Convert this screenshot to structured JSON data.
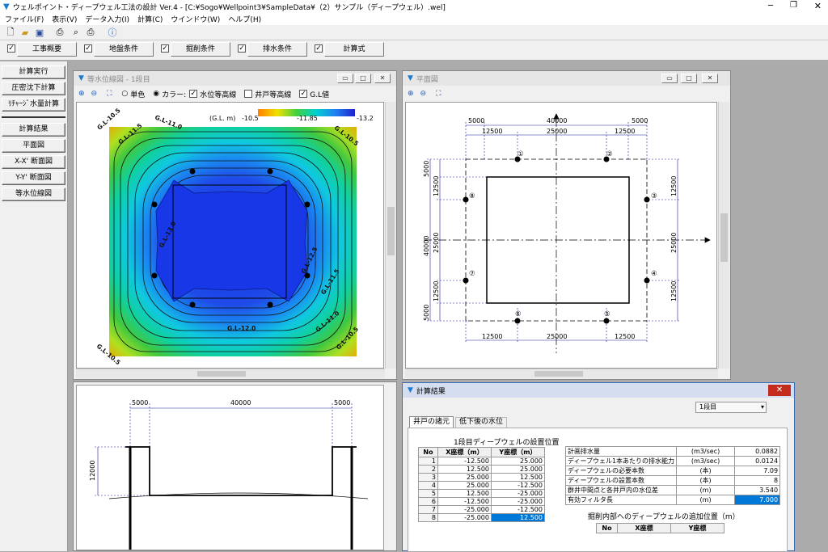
{
  "app": {
    "title": "ウェルポイント・ディープウェル工法の設計 Ver.4 - [C:¥Sogo¥Wellpoint3¥SampleData¥（2）サンプル（ディープウェル）.wel]",
    "menu": [
      "ファイル(F)",
      "表示(V)",
      "データ入力(I)",
      "計算(C)",
      "ウインドウ(W)",
      "ヘルプ(H)"
    ]
  },
  "tabs": [
    {
      "label": "工事概要",
      "checked": true
    },
    {
      "label": "地盤条件",
      "checked": true
    },
    {
      "label": "掘削条件",
      "checked": true
    },
    {
      "label": "排水条件",
      "checked": true
    },
    {
      "label": "計算式",
      "checked": true
    }
  ],
  "sidebar": {
    "top": [
      "計算実行",
      "圧密沈下計算",
      "ﾘﾁｬｰｼﾞ水量計算"
    ],
    "bottom": [
      "計算結果",
      "平面図",
      "X-X' 断面図",
      "Y-Y' 断面図",
      "等水位線図"
    ]
  },
  "contour": {
    "title": "等水位線図 - 1段目",
    "mono": "単色",
    "color": "カラー:",
    "opt1": "水位等高線",
    "opt2": "井戸等高線",
    "opt3": "G.L値",
    "unit": "(G.L. m)",
    "min": "-10.5",
    "mid": "-11.85",
    "max": "-13.2",
    "labels": [
      "G.L-10.5",
      "G.L-11.5",
      "G.L-11.0",
      "G.L-11.5",
      "G.L-10.5",
      "G.L-13.0",
      "G.L-12.5",
      "G.L-11.5",
      "G.L-12.0",
      "G.L-11.0",
      "G.L-10.5",
      "G.L-10.5"
    ]
  },
  "plan": {
    "title": "平面図",
    "dims_top": [
      "5000",
      "40000",
      "5000"
    ],
    "dims_top2": [
      "12500",
      "25000",
      "12500"
    ],
    "dims_bottom": [
      "12500",
      "25000",
      "12500"
    ],
    "dims_left": [
      "5000",
      "12500",
      "25000",
      "12500",
      "5000"
    ],
    "dims_left_total": "40000",
    "dims_right": [
      "12500",
      "25000",
      "12500"
    ],
    "wells": [
      "①",
      "②",
      "③",
      "④",
      "⑤",
      "⑥",
      "⑦",
      "⑧"
    ]
  },
  "section": {
    "dims": [
      "5000",
      "40000",
      "5000"
    ],
    "depth": "12000"
  },
  "result": {
    "title": "計算結果",
    "stage": "1段目",
    "tab1": "井戸の諸元",
    "tab2": "低下後の水位",
    "table_title": "1段目ディープウェルの設置位置",
    "cols": [
      "No",
      "X座標（m）",
      "Y座標（m）"
    ],
    "rows": [
      [
        "1",
        "-12.500",
        "25.000"
      ],
      [
        "2",
        "12.500",
        "25.000"
      ],
      [
        "3",
        "25.000",
        "12.500"
      ],
      [
        "4",
        "25.000",
        "-12.500"
      ],
      [
        "5",
        "12.500",
        "-25.000"
      ],
      [
        "6",
        "-12.500",
        "-25.000"
      ],
      [
        "7",
        "-25.000",
        "-12.500"
      ],
      [
        "8",
        "-25.000",
        "12.500"
      ]
    ],
    "props": [
      [
        "計画排水量",
        "(m3/sec)",
        "0.0882"
      ],
      [
        "ディープウェル1本あたりの排水能力",
        "(m3/sec)",
        "0.0124"
      ],
      [
        "ディープウェルの必要本数",
        "(本)",
        "7.09"
      ],
      [
        "ディープウェルの設置本数",
        "(本)",
        "8"
      ],
      [
        "群井中間点と各井戸内の水位差",
        "(m)",
        "3.540"
      ],
      [
        "有効フィルタ長",
        "(m)",
        "7.000"
      ]
    ],
    "add_title": "掘削内部へのディープウェルの追加位置（m）",
    "add_cols": [
      "No",
      "X座標",
      "Y座標"
    ]
  }
}
